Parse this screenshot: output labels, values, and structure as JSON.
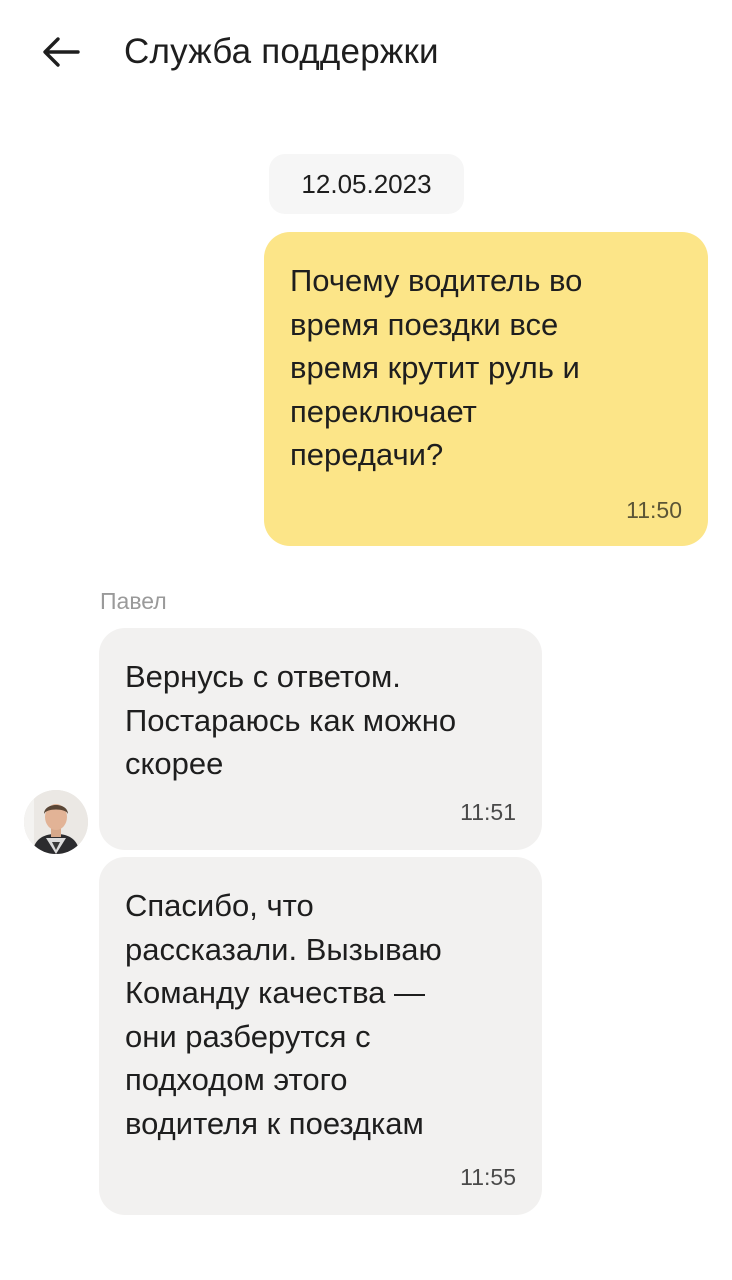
{
  "header": {
    "title": "Служба поддержки",
    "back_icon": "arrow-left-icon"
  },
  "chat": {
    "date": "12.05.2023",
    "messages": [
      {
        "direction": "outgoing",
        "text": "Почему водитель во\nвремя поездки все\nвремя крутит руль и\nпереключает\nпередачи?",
        "time": "11:50"
      },
      {
        "direction": "incoming",
        "sender": "Павел",
        "text": "Вернусь с ответом.\nПостараюсь как можно\nскорее",
        "time": "11:51"
      },
      {
        "direction": "incoming",
        "text": "Спасибо, что\nрассказали. Вызываю\nКоманду качества —\nони разберутся с\nподходом этого\nводителя к поездкам",
        "time": "11:55"
      }
    ]
  },
  "colors": {
    "outgoing_bubble": "#fce588",
    "incoming_bubble": "#f2f1f0",
    "date_chip": "#f6f6f6"
  }
}
